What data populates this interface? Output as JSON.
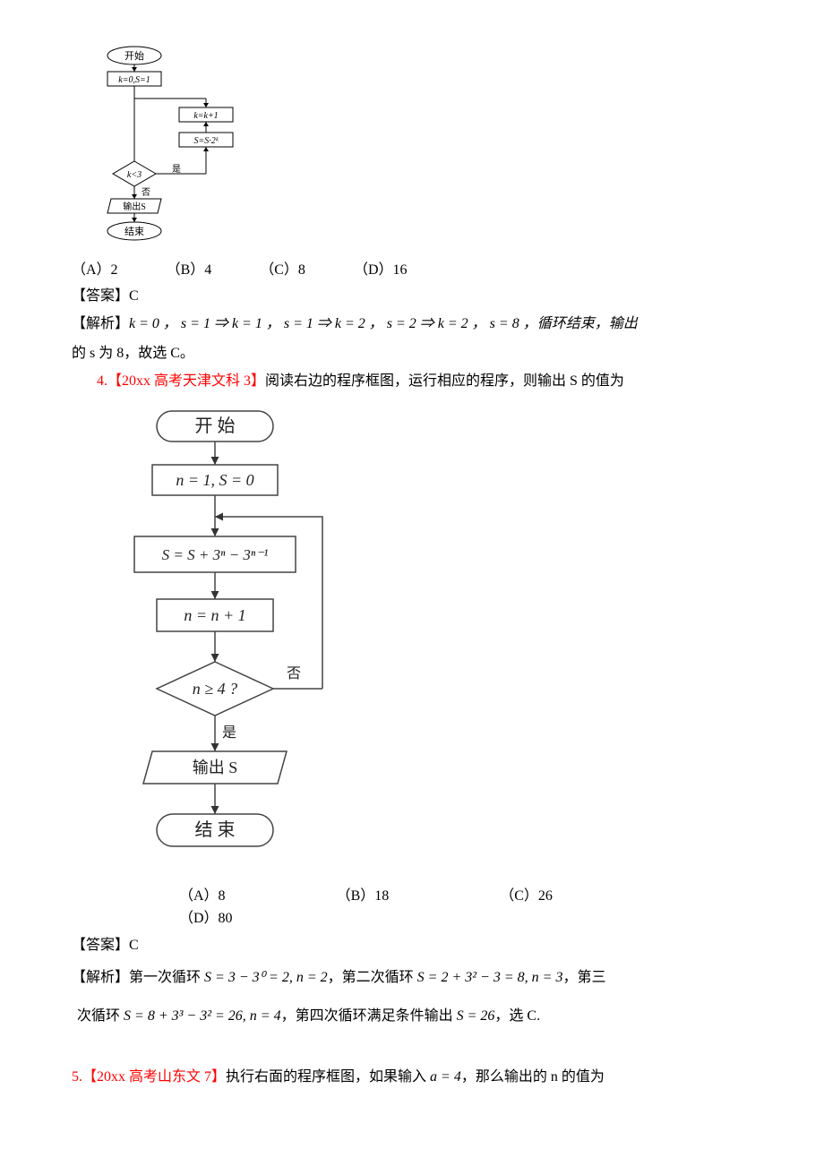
{
  "flowchart1": {
    "start": "开始",
    "init": "k=0,S=1",
    "step1": "k=k+1",
    "step2": "S=S·2ᵏ",
    "cond": "k<3",
    "yes": "是",
    "no": "否",
    "output": "输出S",
    "end": "结束"
  },
  "q3_options": {
    "a": "（A）2",
    "b": "（B）4",
    "c": "（C）8",
    "d": "（D）16"
  },
  "q3_answer_label": "【答案】C",
  "q3_analysis_label": "【解析】",
  "q3_analysis_text1": "k = 0 ， s = 1 ⇒ k = 1 ， s = 1 ⇒ k = 2 ， s = 2 ⇒ k = 2 ， s = 8 ，循环结束，输出",
  "q3_analysis_text2": "的 s 为 8，故选 C。",
  "q4_num": "4.",
  "q4_source": "【20xx 高考天津文科 3】",
  "q4_text": "阅读右边的程序框图，运行相应的程序，则输出 S 的值为",
  "flowchart2": {
    "start": "开 始",
    "init": "n = 1, S = 0",
    "step1": "S = S + 3ⁿ − 3ⁿ⁻¹",
    "step2": "n = n + 1",
    "cond": "n ≥ 4 ?",
    "yes": "是",
    "no": "否",
    "output": "输出  S",
    "end": "结  束"
  },
  "q4_options": {
    "a": "（A）8",
    "b": "（B）18",
    "c": "（C）26",
    "d": "（D）80"
  },
  "q4_answer_label": "【答案】C",
  "q4_analysis_label": "【解析】",
  "q4_analysis_text1a": "第一次循环 ",
  "q4_analysis_text1b": "S = 3 − 3⁰ = 2, n = 2",
  "q4_analysis_text1c": "，第二次循环 ",
  "q4_analysis_text1d": "S = 2 + 3² − 3 = 8, n = 3",
  "q4_analysis_text1e": "，第三",
  "q4_analysis_text2a": "次循环 ",
  "q4_analysis_text2b": "S = 8 + 3³ − 3² = 26, n = 4",
  "q4_analysis_text2c": "，第四次循环满足条件输出 ",
  "q4_analysis_text2d": "S = 26",
  "q4_analysis_text2e": "，选 C.",
  "q5_num": "5.",
  "q5_source": "【20xx 高考山东文 7】",
  "q5_text1": "执行右面的程序框图，如果输入 ",
  "q5_math": "a = 4",
  "q5_text2": "，那么输出的 n 的值为"
}
